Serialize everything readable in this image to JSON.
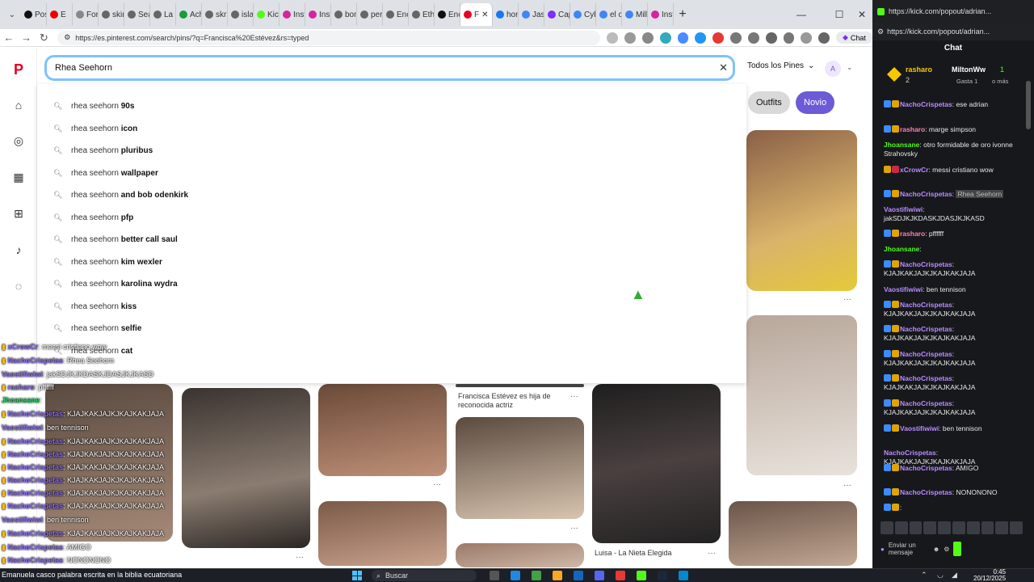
{
  "tabs": [
    "Post",
    "E",
    "Forn",
    "skin",
    "Sear",
    "La R",
    "Achi",
    "skril",
    "isla",
    "Kick",
    "Insta",
    "Insta",
    "bon",
    "pers",
    "Encu",
    "Ethn",
    "Encu",
    "F",
    "hom",
    "Jaso",
    "Capt",
    "Cybi",
    "el co",
    "Mille",
    "Insta"
  ],
  "browser": {
    "url": "https://es.pinterest.com/search/pins/?q=Francisca%20Estévez&rs=typed",
    "chat_button": "Chat"
  },
  "search": {
    "value": "Rhea Seehorn",
    "filter": "Todos los Pines",
    "avatar": "A"
  },
  "chips": [
    "Outfits",
    "Novio"
  ],
  "suggestions": [
    {
      "prefix": "rhea seehorn",
      "suffix": "90s"
    },
    {
      "prefix": "rhea seehorn",
      "suffix": "icon"
    },
    {
      "prefix": "rhea seehorn",
      "suffix": "pluribus"
    },
    {
      "prefix": "rhea seehorn",
      "suffix": "wallpaper"
    },
    {
      "prefix": "rhea seehorn",
      "suffix": "and bob odenkirk"
    },
    {
      "prefix": "rhea seehorn",
      "suffix": "pfp"
    },
    {
      "prefix": "rhea seehorn",
      "suffix": "better call saul"
    },
    {
      "prefix": "rhea seehorn",
      "suffix": "kim wexler"
    },
    {
      "prefix": "rhea seehorn",
      "suffix": "karolina wydra"
    },
    {
      "prefix": "rhea seehorn",
      "suffix": "kiss"
    },
    {
      "prefix": "rhea seehorn",
      "suffix": "selfie"
    },
    {
      "prefix": "rhea seehorn",
      "suffix": "cat"
    }
  ],
  "pins": {
    "caption1": "Francisca Estévez es hija de reconocida actriz",
    "caption2": "Luisa - La Nieta Elegida"
  },
  "overlay_chat": [
    {
      "user": "xCrowCr",
      "text": "messi cristiano wow"
    },
    {
      "user": "NachoCrispetas",
      "text": "Rhea Seehorn"
    },
    {
      "user": "Vaostifiwiwi",
      "text": "jakSDJKJKDASKJDASJKJKASD"
    },
    {
      "user": "rasharo",
      "text": "pffffff"
    },
    {
      "user": "Jhoansane",
      "text": ""
    },
    {
      "user": "NachoCrispetas",
      "text": "KJAJKAKJAJKJKAJKAKJAJA"
    },
    {
      "user": "Vaostifiwiwi",
      "text": "ben tennison"
    },
    {
      "user": "NachoCrispetas",
      "text": "KJAJKAKJAJKJKAJKAKJAJA"
    },
    {
      "user": "NachoCrispetas",
      "text": "KJAJKAKJAJKJKAJKAKJAJA"
    },
    {
      "user": "NachoCrispetas",
      "text": "KJAJKAKJAJKJKAJKAKJAJA"
    },
    {
      "user": "NachoCrispetas",
      "text": "KJAJKAKJAJKJKAJKAKJAJA"
    },
    {
      "user": "NachoCrispetas",
      "text": "KJAJKAKJAJKJKAJKAKJAJA"
    },
    {
      "user": "NachoCrispetas",
      "text": "KJAJKAKJAJKJKAJKAKJAJA"
    },
    {
      "user": "Vaostifiwiwi",
      "text": "ben tennison"
    },
    {
      "user": "NachoCrispetas",
      "text": "KJAJKAKJAJKJKAJKAKJAJA"
    },
    {
      "user": "NachoCrispetas",
      "text": "AMIGO"
    },
    {
      "user": "NachoCrispetas",
      "text": "NONONONO"
    }
  ],
  "kick": {
    "url": "https://kick.com/popout/adrian...",
    "url_full": "https://kick.com/popout/adrian...",
    "header": "Chat",
    "gift_user1": "rasharo",
    "gift_count1": "2",
    "gift_user2": "MiltonWw",
    "gift_count2": "1",
    "gift_note": "Gasta 1",
    "gift_more": "o más",
    "messages": [
      {
        "user": "NachoCrispetas",
        "text": "ese adrian"
      },
      {
        "user": "rasharo",
        "text": "marge simpson"
      },
      {
        "user": "Jhoansane",
        "text": "otro formidable de oro ivonne Strahovsky"
      },
      {
        "user": "xCrowCr",
        "text": "messi cristiano wow"
      },
      {
        "user": "NachoCrispetas",
        "text": "Rhea Seehorn"
      },
      {
        "user": "Vaostifiwiwi",
        "text": "jakSDJKJKDASKJDASJKJKASD"
      },
      {
        "user": "rasharo",
        "text": "pffffff"
      },
      {
        "user": "Jhoansane",
        "text": ""
      },
      {
        "user": "NachoCrispetas",
        "text": "KJAJKAKJAJKJKAJKAKJAJA"
      },
      {
        "user": "Vaostifiwiwi",
        "text": "ben tennison"
      },
      {
        "user": "NachoCrispetas",
        "text": "KJAJKAKJAJKJKAJKAKJAJA"
      },
      {
        "user": "NachoCrispetas",
        "text": "KJAJKAKJAJKJKAJKAKJAJA"
      },
      {
        "user": "NachoCrispetas",
        "text": "KJAJKAKJAJKJKAJKAKJAJA"
      },
      {
        "user": "NachoCrispetas",
        "text": "KJAJKAKJAJKJKAJKAKJAJA"
      },
      {
        "user": "NachoCrispetas",
        "text": "KJAJKAKJAJKJKAJKAKJAJA"
      },
      {
        "user": "Vaostifiwiwi",
        "text": "ben tennison"
      },
      {
        "user": "NachoCrispetas",
        "text": "KJAJKAKJAJKJKAJKAKJAJA"
      },
      {
        "user": "NachoCrispetas",
        "text": "AMIGO"
      },
      {
        "user": "NachoCrispetas",
        "text": "NONONONO"
      }
    ],
    "input_placeholder": "Enviar un mensaje"
  },
  "taskbar": {
    "news": "Emanuela casco palabra escrita en la biblia ecuatoriana",
    "search": "Buscar",
    "time": "0:45",
    "date": "20/12/2025"
  },
  "colors": {
    "pinterest_red": "#e60023",
    "chip_gray": "#d9d9d9",
    "chip_purple": "#6b5bd6",
    "kick_green": "#53fc18",
    "search_focus": "#7fc1ff"
  }
}
